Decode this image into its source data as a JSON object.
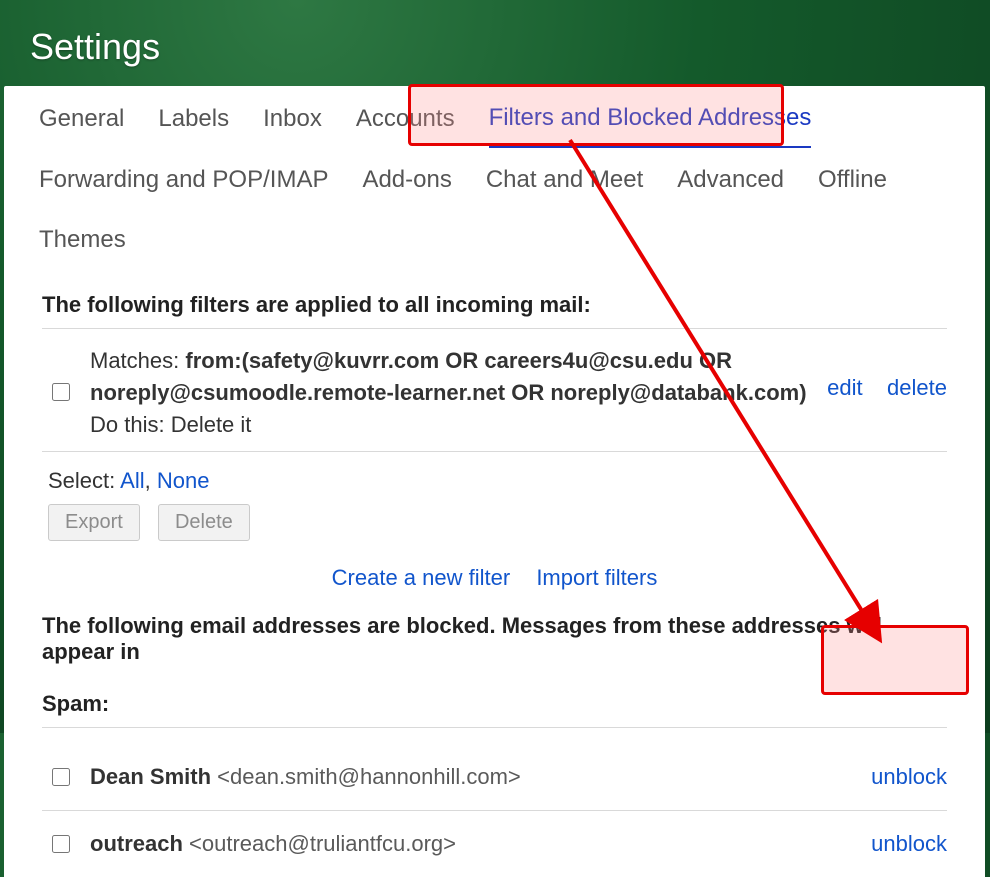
{
  "page_title": "Settings",
  "tabs_row1": [
    "General",
    "Labels",
    "Inbox",
    "Accounts",
    "Filters and Blocked Addresses"
  ],
  "tabs_row2": [
    "Forwarding and POP/IMAP",
    "Add-ons",
    "Chat and Meet",
    "Advanced",
    "Offline",
    "Themes"
  ],
  "active_tab": "Filters and Blocked Addresses",
  "filters_heading": "The following filters are applied to all incoming mail:",
  "filter": {
    "matches_label": "Matches: ",
    "matches": "from:(safety@kuvrr.com OR careers4u@csu.edu OR noreply@csumoodle.remote-learner.net OR noreply@databank.com)",
    "do_label": "Do this: ",
    "do_value": "Delete it",
    "edit": "edit",
    "delete": "delete"
  },
  "select_label": "Select: ",
  "select_all": "All",
  "select_none": "None",
  "export_btn": "Export",
  "delete_btn": "Delete",
  "create_filter": "Create a new filter",
  "import_filters": "Import filters",
  "blocked_heading_1": "The following email addresses are blocked. Messages from these addresses will appear in",
  "blocked_heading_2": "Spam:",
  "blocked": [
    {
      "name": "Dean Smith",
      "email": "<dean.smith@hannonhill.com>",
      "unblock": "unblock"
    },
    {
      "name": "outreach",
      "email": "<outreach@truliantfcu.org>",
      "unblock": "unblock"
    }
  ]
}
